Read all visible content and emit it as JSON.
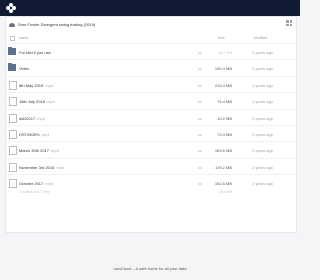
{
  "app": {
    "breadcrumb": "Sree Fowler Divergent swing trading (2019)",
    "footer": "ownCloud – A safe home for all your data"
  },
  "table": {
    "headers": {
      "name": "Name",
      "size": "Size",
      "modified": "Modified"
    },
    "rows": [
      {
        "type": "folder",
        "name": "For Mid if you use",
        "ext": "",
        "share": "",
        "size": "647 KB",
        "size_dim": true,
        "modified": "2 years ago"
      },
      {
        "type": "folder",
        "name": "Video",
        "ext": "",
        "share": "",
        "size": "190.4 MB",
        "size_dim": false,
        "modified": "2 years ago"
      },
      {
        "type": "file",
        "name": "8th May 2019",
        "ext": ".mp4",
        "share": "",
        "size": "215.4 MB",
        "size_dim": false,
        "modified": "2 years ago"
      },
      {
        "type": "file",
        "name": "18th July 2016",
        "ext": ".mp4",
        "share": "",
        "size": "74.4 MB",
        "size_dim": false,
        "modified": "2 years ago"
      },
      {
        "type": "file",
        "name": "dst20117",
        "ext": ".mp4",
        "share": "",
        "size": "10.2 MB",
        "size_dim": false,
        "modified": "2 years ago"
      },
      {
        "type": "file",
        "name": "DST0505%",
        "ext": ".mp4",
        "share": "",
        "size": "73.4 MB",
        "size_dim": false,
        "modified": "2 years ago"
      },
      {
        "type": "file",
        "name": "March 30th 2017",
        "ext": ".mp4",
        "share": "",
        "size": "169.6 MB",
        "size_dim": false,
        "modified": "2 years ago"
      },
      {
        "type": "file",
        "name": "November 3rd 2016",
        "ext": ".mp4",
        "share": "",
        "size": "119.2 MB",
        "size_dim": false,
        "modified": "2 years ago"
      },
      {
        "type": "file",
        "name": "October 2017",
        "ext": ".mp4",
        "share": "",
        "size": "162.5 MB",
        "size_dim": false,
        "modified": "2 years ago"
      }
    ],
    "summary": {
      "label": "2 folders and 7 files",
      "size": "1014 MB"
    }
  }
}
